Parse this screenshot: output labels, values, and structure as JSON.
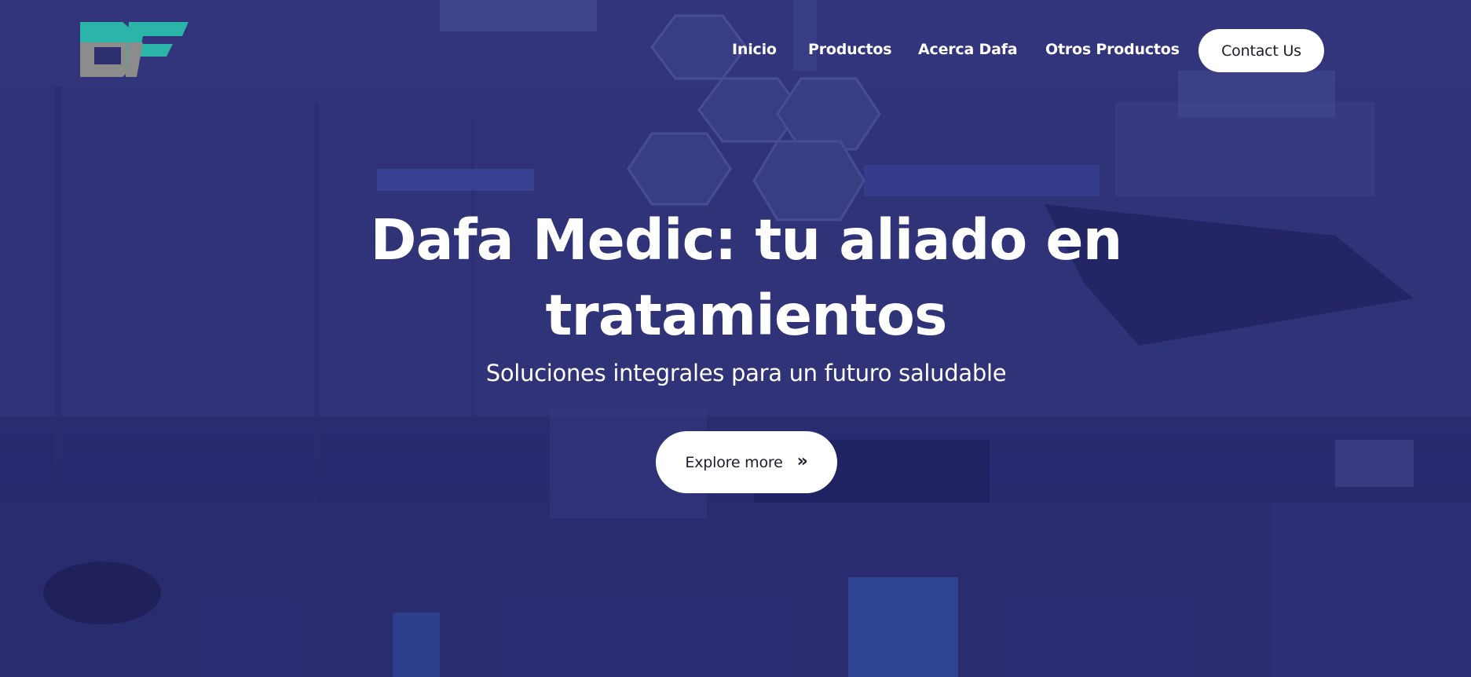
{
  "header": {
    "logo_icon": "df-logo-icon",
    "nav": [
      {
        "label": "Inicio"
      },
      {
        "label": "Productos"
      },
      {
        "label": "Acerca Dafa"
      },
      {
        "label": "Otros Productos"
      }
    ],
    "contact_label": "Contact Us"
  },
  "hero": {
    "title_line1": "Dafa Medic: tu aliado en",
    "title_line2": "tratamientos",
    "subtitle": "Soluciones integrales para un futuro saludable",
    "cta_label": "Explore more",
    "cta_icon": "double-chevron-right-icon"
  },
  "colors": {
    "overlay": "#2d2f6e",
    "logo_teal": "#2bb5a8",
    "logo_gray": "#8c8c8c",
    "button_bg": "#ffffff",
    "text": "#ffffff"
  }
}
